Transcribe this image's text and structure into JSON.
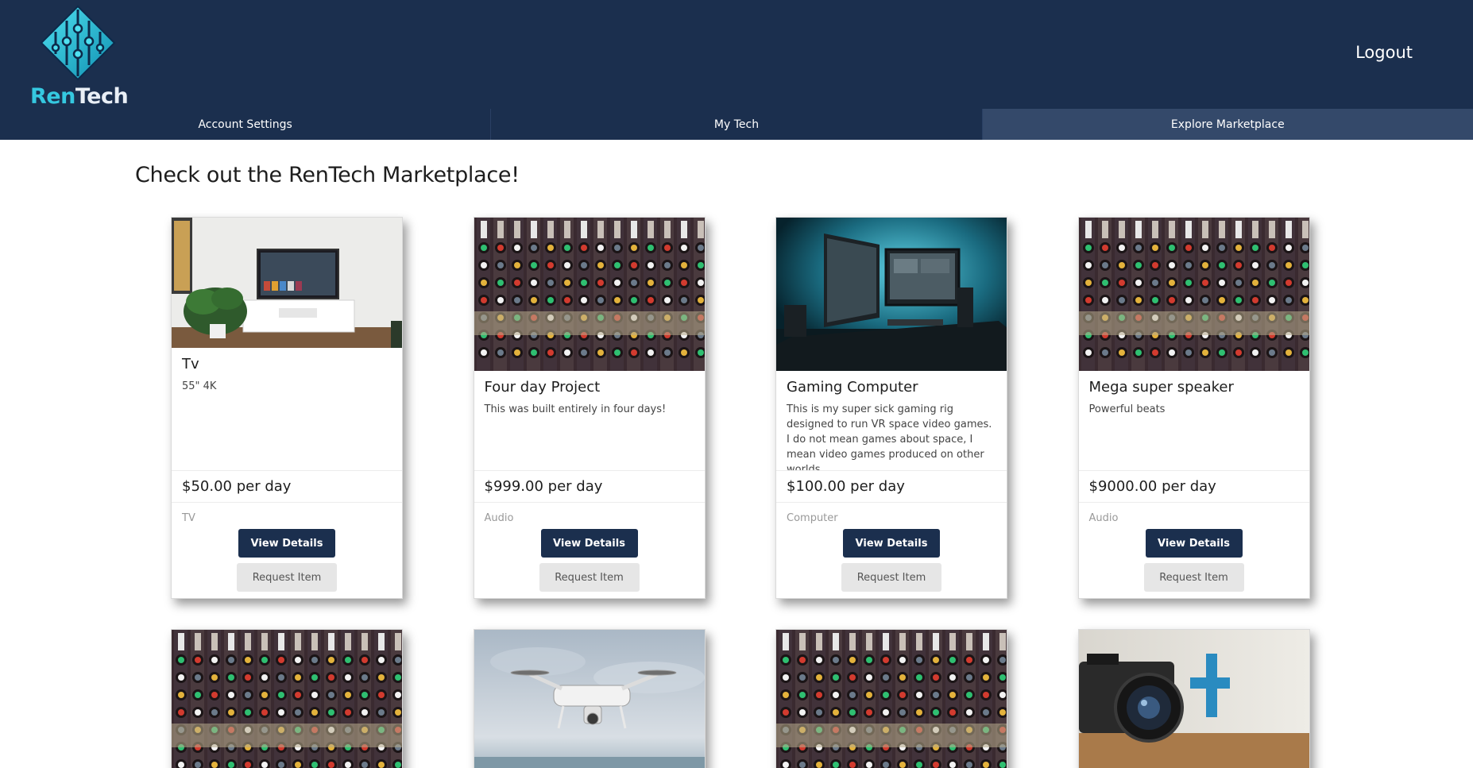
{
  "brand": {
    "part1": "Ren",
    "part2": "Tech"
  },
  "header": {
    "logout_label": "Logout"
  },
  "tabs": [
    {
      "label": "Account Settings",
      "active": false
    },
    {
      "label": "My Tech",
      "active": false
    },
    {
      "label": "Explore Marketplace",
      "active": true
    }
  ],
  "page": {
    "title": "Check out the RenTech Marketplace!"
  },
  "buttons": {
    "view": "View Details",
    "request": "Request Item"
  },
  "cards": [
    {
      "image": "tv-room-photo",
      "title": "Tv",
      "description": "55\" 4K",
      "price": "$50.00 per day",
      "category": "TV"
    },
    {
      "image": "audio-mixer-photo",
      "title": "Four day Project",
      "description": "This was built entirely in four days!",
      "price": "$999.00 per day",
      "category": "Audio"
    },
    {
      "image": "gaming-desk-photo",
      "title": "Gaming Computer",
      "description": "This is my super sick gaming rig designed to run VR space video games. I do not mean games about space, I mean video games produced on other worlds.",
      "price": "$100.00 per day",
      "category": "Computer"
    },
    {
      "image": "audio-mixer-photo",
      "title": "Mega super speaker",
      "description": "Powerful beats",
      "price": "$9000.00 per day",
      "category": "Audio"
    },
    {
      "image": "audio-mixer-photo"
    },
    {
      "image": "drone-photo"
    },
    {
      "image": "audio-mixer-photo"
    },
    {
      "image": "camera-photo"
    }
  ],
  "colors": {
    "navy": "#1b2f4e",
    "active_tab": "#34496a",
    "brand_cyan": "#35c8e0"
  }
}
